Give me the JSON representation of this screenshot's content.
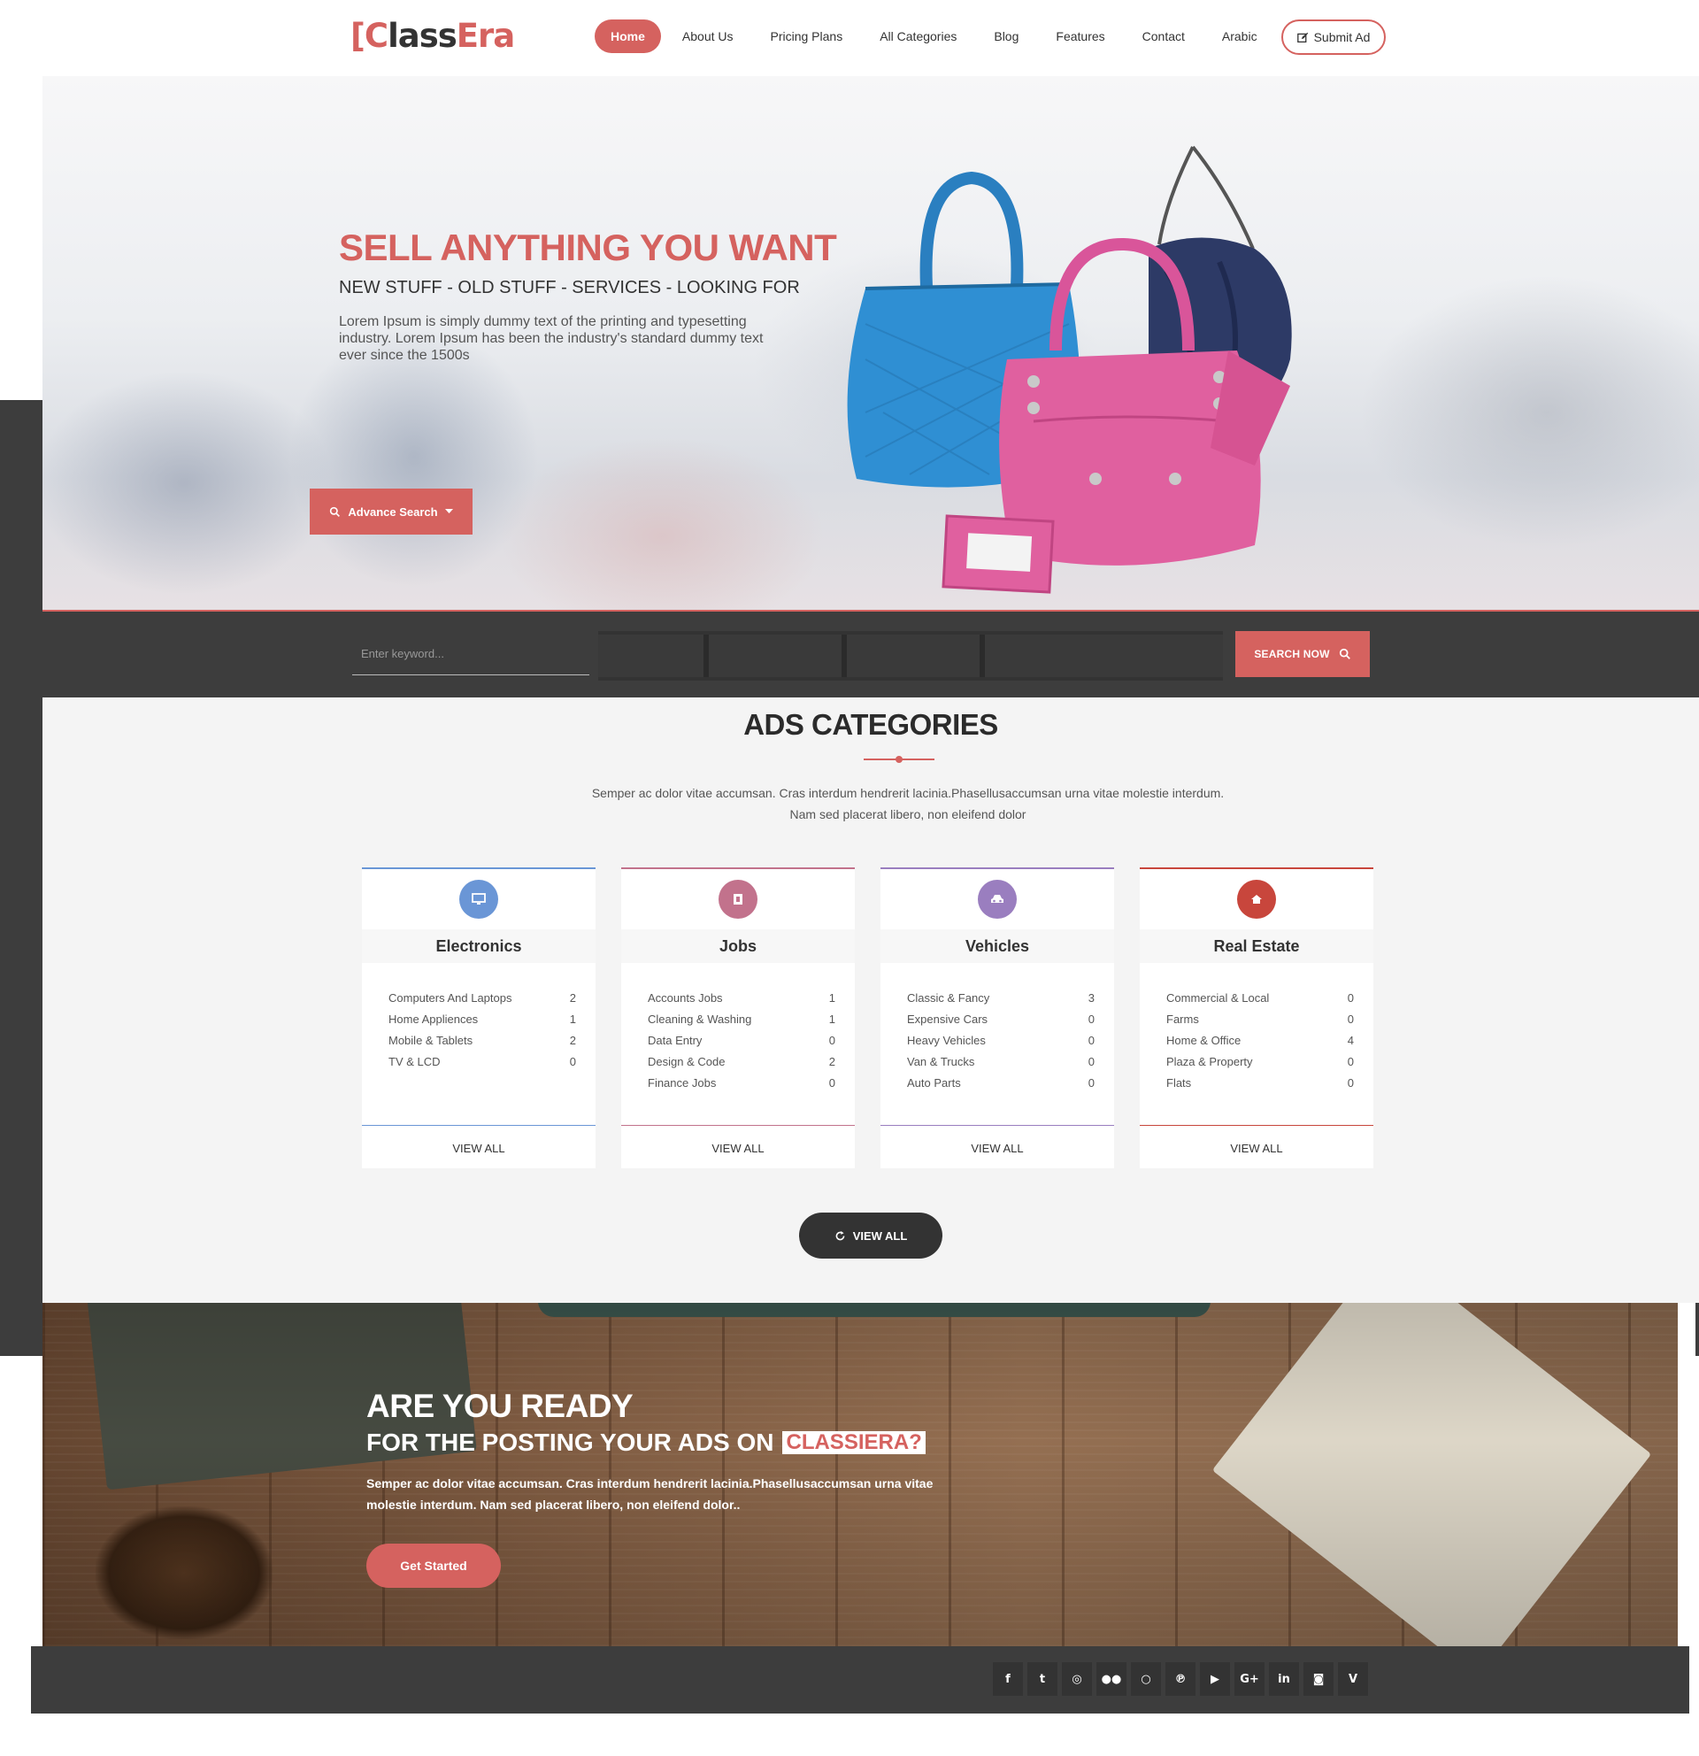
{
  "header": {
    "logo": {
      "part1": "[C",
      "part2": "lass",
      "part3": "Era"
    },
    "nav": [
      "Home",
      "About Us",
      "Pricing Plans",
      "All Categories",
      "Blog",
      "Features",
      "Contact",
      "Arabic"
    ],
    "active_nav": "Home",
    "submit_ad": "Submit Ad"
  },
  "hero": {
    "title": "SELL ANYTHING YOU WANT",
    "subtitle": "NEW STUFF - OLD STUFF - SERVICES - LOOKING FOR",
    "text": "Lorem Ipsum is simply dummy text of the printing and typesetting industry. Lorem Ipsum has been the industry's standard dummy text ever since the 1500s",
    "advance_search": "Advance Search"
  },
  "search": {
    "keyword_placeholder": "Enter keyword...",
    "search_now": "SEARCH NOW"
  },
  "categories": {
    "title": "ADS CATEGORIES",
    "description": "Semper ac dolor vitae accumsan. Cras interdum hendrerit lacinia.Phasellusaccumsan urna vitae molestie interdum. Nam sed placerat libero, non eleifend dolor",
    "cards": [
      {
        "name": "Electronics",
        "icon": "monitor-icon",
        "color": "#6a96d6",
        "items": [
          {
            "label": "Computers And Laptops",
            "count": "2"
          },
          {
            "label": "Home Appliences",
            "count": "1"
          },
          {
            "label": "Mobile & Tablets",
            "count": "2"
          },
          {
            "label": "TV & LCD",
            "count": "0"
          }
        ],
        "view_all": "VIEW ALL"
      },
      {
        "name": "Jobs",
        "icon": "id-card-icon",
        "color": "#c2728c",
        "items": [
          {
            "label": "Accounts Jobs",
            "count": "1"
          },
          {
            "label": "Cleaning & Washing",
            "count": "1"
          },
          {
            "label": "Data Entry",
            "count": "0"
          },
          {
            "label": "Design & Code",
            "count": "2"
          },
          {
            "label": "Finance Jobs",
            "count": "0"
          }
        ],
        "view_all": "VIEW ALL"
      },
      {
        "name": "Vehicles",
        "icon": "car-icon",
        "color": "#9a7ebf",
        "items": [
          {
            "label": "Classic & Fancy",
            "count": "3"
          },
          {
            "label": "Expensive Cars",
            "count": "0"
          },
          {
            "label": "Heavy Vehicles",
            "count": "0"
          },
          {
            "label": "Van & Trucks",
            "count": "0"
          },
          {
            "label": "Auto Parts",
            "count": "0"
          }
        ],
        "view_all": "VIEW ALL"
      },
      {
        "name": "Real Estate",
        "icon": "home-icon",
        "color": "#c8463c",
        "items": [
          {
            "label": "Commercial & Local",
            "count": "0"
          },
          {
            "label": "Farms",
            "count": "0"
          },
          {
            "label": "Home & Office",
            "count": "4"
          },
          {
            "label": "Plaza & Property",
            "count": "0"
          },
          {
            "label": "Flats",
            "count": "0"
          }
        ],
        "view_all": "VIEW ALL"
      }
    ],
    "view_all": "VIEW ALL"
  },
  "cta": {
    "title": "ARE YOU READY",
    "subtitle": "FOR THE POSTING YOUR ADS ON",
    "highlight": "CLASSIERA?",
    "text": "Semper ac dolor vitae accumsan. Cras interdum hendrerit lacinia.Phasellusaccumsan urna vitae molestie interdum. Nam sed placerat libero, non eleifend dolor..",
    "button": "Get Started"
  },
  "footer": {
    "socials": [
      {
        "name": "facebook-icon",
        "glyph": "f"
      },
      {
        "name": "twitter-icon",
        "glyph": "t"
      },
      {
        "name": "dribbble-icon",
        "glyph": "◎"
      },
      {
        "name": "flickr-icon",
        "glyph": "●●"
      },
      {
        "name": "github-icon",
        "glyph": "○"
      },
      {
        "name": "pinterest-icon",
        "glyph": "℗"
      },
      {
        "name": "youtube-icon",
        "glyph": "▶"
      },
      {
        "name": "google-plus-icon",
        "glyph": "G+"
      },
      {
        "name": "linkedin-icon",
        "glyph": "in"
      },
      {
        "name": "instagram-icon",
        "glyph": "◙"
      },
      {
        "name": "vimeo-icon",
        "glyph": "V"
      }
    ]
  },
  "colors": {
    "accent": "#d5625f",
    "dark": "#3d3d3d",
    "section_bg": "#f4f4f4"
  }
}
